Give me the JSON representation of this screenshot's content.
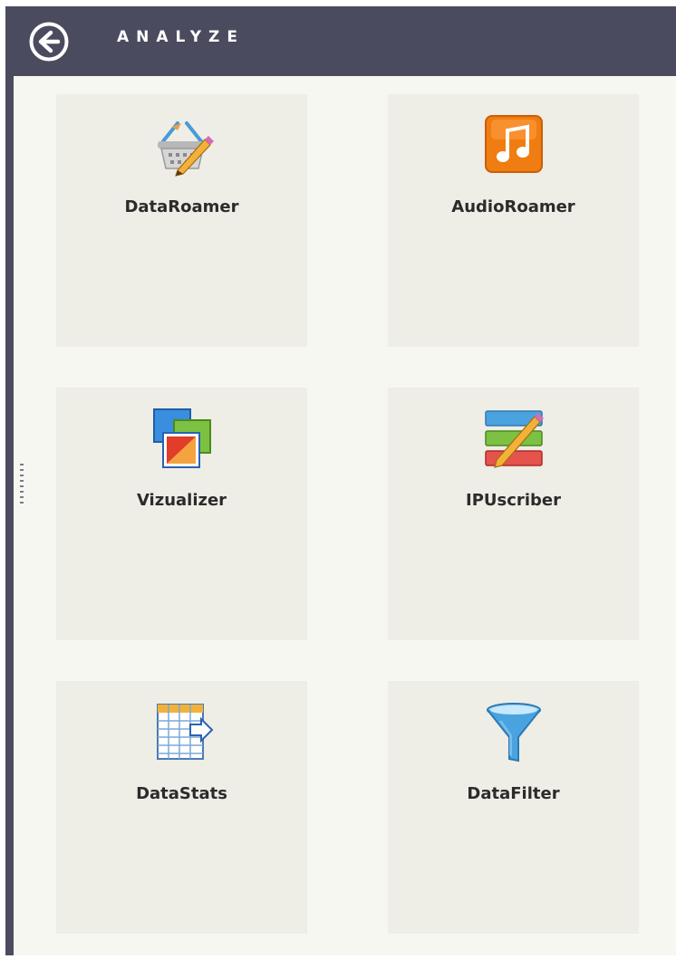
{
  "header": {
    "title": "ANALYZE",
    "back_icon": "back-arrow-circle-icon",
    "background": "#4b4b5f"
  },
  "tiles": [
    {
      "label": "DataRoamer",
      "icon": "basket-pencil-icon"
    },
    {
      "label": "AudioRoamer",
      "icon": "music-note-icon",
      "icon_color": "#f07d12"
    },
    {
      "label": "Vizualizer",
      "icon": "overlapping-images-icon"
    },
    {
      "label": "IPUscriber",
      "icon": "striped-list-pencil-icon"
    },
    {
      "label": "DataStats",
      "icon": "table-arrow-icon"
    },
    {
      "label": "DataFilter",
      "icon": "funnel-icon",
      "icon_color": "#4aa3df"
    }
  ]
}
